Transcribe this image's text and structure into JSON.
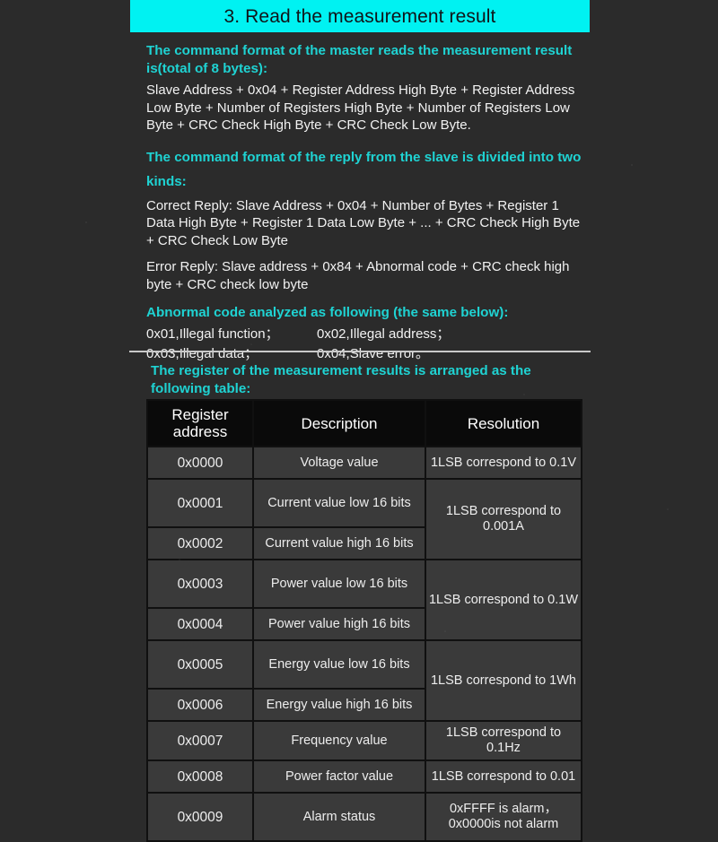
{
  "banner": {
    "title": "3. Read the measurement result"
  },
  "sections": [
    {
      "heading": "The command format of the master reads the measurement result is(total of 8 bytes):",
      "body": "Slave Address + 0x04 + Register Address High Byte + Register Address Low Byte + Number of Registers High Byte + Number of Registers Low Byte + CRC Check High Byte + CRC Check Low Byte."
    },
    {
      "heading": "The command format of the reply from the slave is divided into two kinds:",
      "body": "Correct Reply: Slave Address + 0x04 + Number of Bytes + Register 1 Data High Byte + Register 1 Data Low Byte + ... + CRC Check High Byte + CRC Check Low Byte",
      "body2": "Error Reply: Slave address + 0x84 + Abnormal code + CRC check high byte + CRC check low byte"
    },
    {
      "heading": "Abnormal code analyzed as following (the same below):"
    }
  ],
  "abnormal_codes": [
    {
      "left": "0x01,Illegal function；",
      "right": "0x02,Illegal address；"
    },
    {
      "left": "0x03,Illegal data；",
      "right": "0x04,Slave error。"
    }
  ],
  "table_section": {
    "heading": "The register of the measurement results is arranged as the following table:",
    "columns": [
      "Register address",
      "Description",
      "Resolution"
    ],
    "rows": [
      {
        "address": "0x0000",
        "description": "Voltage value",
        "resolution": "1LSB correspond to 0.1V",
        "res_rowspan": 1
      },
      {
        "address": "0x0001",
        "description": "Current value low 16 bits",
        "resolution": "1LSB correspond to 0.001A",
        "res_rowspan": 2
      },
      {
        "address": "0x0002",
        "description": "Current value high 16 bits",
        "resolution": null
      },
      {
        "address": "0x0003",
        "description": "Power value low 16 bits",
        "resolution": "1LSB correspond to 0.1W",
        "res_rowspan": 2
      },
      {
        "address": "0x0004",
        "description": "Power value high 16 bits",
        "resolution": null
      },
      {
        "address": "0x0005",
        "description": "Energy value low 16 bits",
        "resolution": "1LSB correspond to 1Wh",
        "res_rowspan": 2
      },
      {
        "address": "0x0006",
        "description": "Energy value high 16 bits",
        "resolution": null
      },
      {
        "address": "0x0007",
        "description": "Frequency value",
        "resolution": "1LSB correspond to 0.1Hz",
        "res_rowspan": 1
      },
      {
        "address": "0x0008",
        "description": "Power factor value",
        "resolution": "1LSB correspond to 0.01",
        "res_rowspan": 1
      },
      {
        "address": "0x0009",
        "description": "Alarm status",
        "resolution": "0xFFFF is alarm，\n0x0000is not alarm",
        "res_rowspan": 1
      }
    ]
  },
  "colors": {
    "banner_bg": "#00f2f2",
    "banner_text": "#101418",
    "heading_cyan": "#1fd3d3",
    "body_text": "#f2f2f2",
    "page_bg": "#2b2b2b",
    "table_header_bg": "#0a0a0a",
    "table_cell_bg": "#3a3a3a",
    "table_grid": "#101010",
    "divider": "#c9c9c9"
  }
}
